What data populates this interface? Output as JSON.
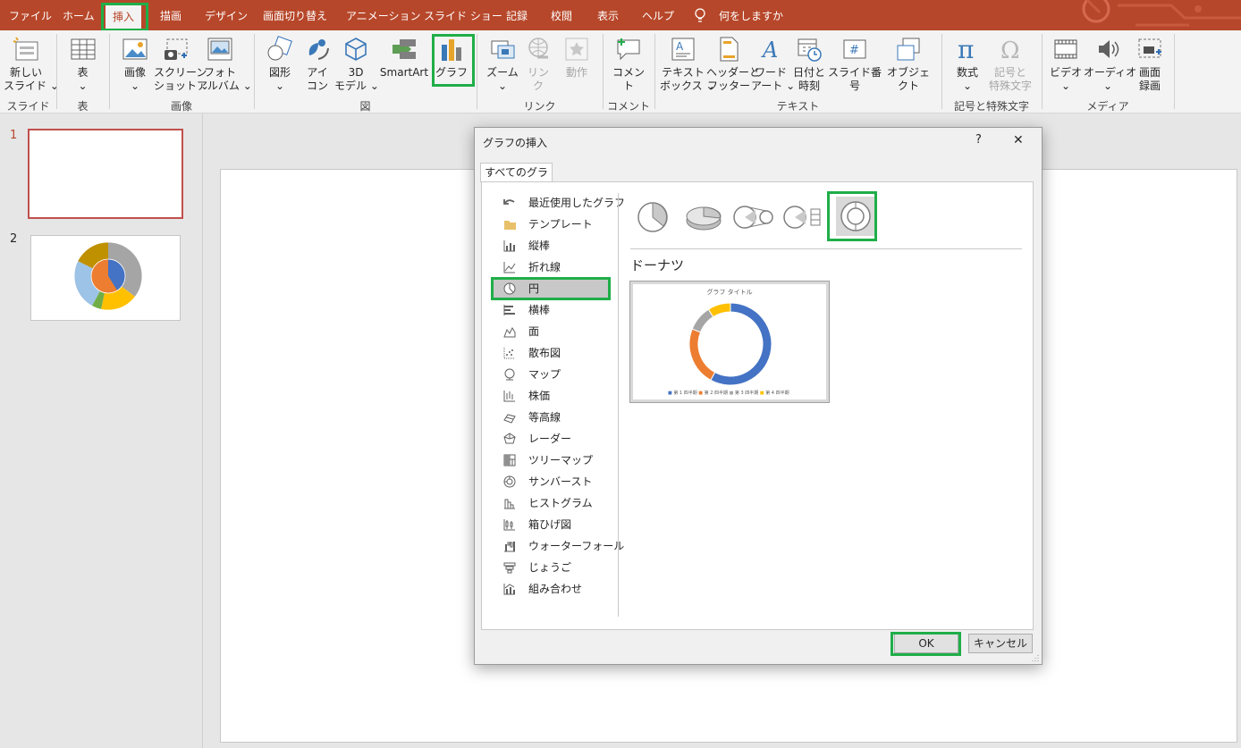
{
  "menu": {
    "items": [
      "ファイル",
      "ホーム",
      "挿入",
      "描画",
      "デザイン",
      "画面切り替え",
      "アニメーション",
      "スライド ショー",
      "記録",
      "校閲",
      "表示",
      "ヘルプ"
    ],
    "search_label": "何をしますか"
  },
  "ribbon": {
    "new_slide": "新しい\nスライド ⌄",
    "table": "表\n⌄",
    "picture": "画像\n⌄",
    "screenshot": "スクリーン\nショット ⌄",
    "photo_album": "フォト\nアルバム ⌄",
    "shapes": "図形\n⌄",
    "icons": "アイ\nコン",
    "model3d": "3D\nモデル ⌄",
    "smartart": "SmartArt",
    "chart": "グラフ",
    "zoom": "ズーム\n⌄",
    "link": "リン\nク",
    "action": "動作",
    "comment": "コメント",
    "textbox": "テキスト\nボックス ⌄",
    "header_footer": "ヘッダーと\nフッター",
    "wordart": "ワード\nアート ⌄",
    "datetime": "日付と\n時刻",
    "slide_number": "スライド番号",
    "object": "オブジェクト",
    "equation": "数式\n⌄",
    "symbol": "記号と\n特殊文字",
    "video": "ビデオ\n⌄",
    "audio": "オーディオ\n⌄",
    "screen_record": "画面\n録画",
    "groups": {
      "slides": "スライド",
      "tables": "表",
      "images": "画像",
      "illustrations": "図",
      "links": "リンク",
      "comments": "コメント",
      "text": "テキスト",
      "symbols": "記号と特殊文字",
      "media": "メディア"
    }
  },
  "thumbnails": {
    "slide1_number": "1",
    "slide2_number": "2"
  },
  "dialog": {
    "title": "グラフの挿入",
    "help": "?",
    "close": "✕",
    "tab": "すべてのグラフ",
    "categories": [
      "最近使用したグラフ",
      "テンプレート",
      "縦棒",
      "折れ線",
      "円",
      "横棒",
      "面",
      "散布図",
      "マップ",
      "株価",
      "等高線",
      "レーダー",
      "ツリーマップ",
      "サンバースト",
      "ヒストグラム",
      "箱ひげ図",
      "ウォーターフォール",
      "じょうご",
      "組み合わせ"
    ],
    "selected_category": "円",
    "selected_subtype": "ドーナツ",
    "preview": {
      "title": "グラフ タイトル",
      "legend": [
        "第 1 四半期",
        "第 2 四半期",
        "第 3 四半期",
        "第 4 四半期"
      ]
    },
    "ok": "OK",
    "cancel": "キャンセル"
  },
  "chart_data": {
    "type": "pie",
    "title": "グラフ タイトル",
    "categories": [
      "第 1 四半期",
      "第 2 四半期",
      "第 3 四半期",
      "第 4 四半期"
    ],
    "values": [
      58,
      23,
      10,
      9
    ],
    "colors": [
      "#4472c4",
      "#ed7d31",
      "#a5a5a5",
      "#ffc000"
    ]
  },
  "colors": {
    "accent": "#b7472a",
    "highlight": "#1fae48",
    "selected_bg": "#c8c8c8"
  }
}
